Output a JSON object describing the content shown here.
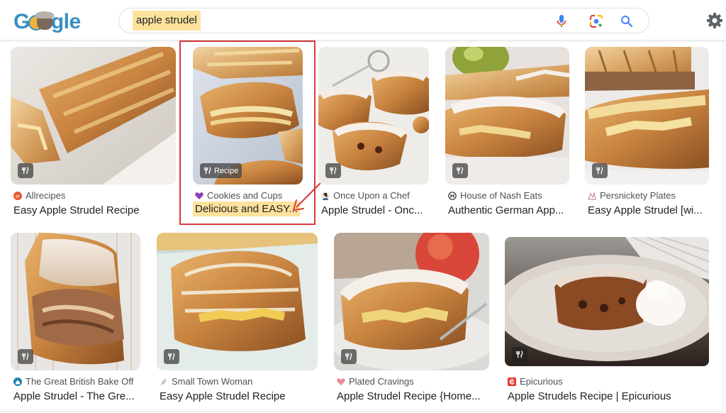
{
  "header": {
    "logo_letters": {
      "g": "G",
      "rest": "gle"
    },
    "search_query": "apple strudel",
    "icons": [
      "microphone-icon",
      "google-lens-icon",
      "search-icon",
      "settings-gear-icon"
    ]
  },
  "colors": {
    "highlight": "#fde29c",
    "annotation_red": "#d93a3a",
    "logo_blue": "#3a8fc2"
  },
  "results": [
    {
      "source": "Allrecipes",
      "title": "Easy Apple Strudel Recipe",
      "badge": "",
      "favicon": "allrecipes-icon"
    },
    {
      "source": "Cookies and Cups",
      "title": "Delicious and EASY...",
      "badge": "Recipe",
      "favicon": "purple-heart-icon",
      "highlighted": true
    },
    {
      "source": "Once Upon a Chef",
      "title": "Apple Strudel - Onc...",
      "badge": "",
      "favicon": "chef-avatar-icon"
    },
    {
      "source": "House of Nash Eats",
      "title": "Authentic German App...",
      "badge": "",
      "favicon": "house-of-nash-icon"
    },
    {
      "source": "Persnickety Plates",
      "title": "Easy Apple Strudel [wi...",
      "badge": "",
      "favicon": "persnickety-icon"
    },
    {
      "source": "The Great British Bake Off",
      "title": "Apple Strudel - The Gre...",
      "badge": "",
      "favicon": "gbbo-icon"
    },
    {
      "source": "Small Town Woman",
      "title": "Easy Apple Strudel Recipe",
      "badge": "",
      "favicon": "small-town-woman-icon"
    },
    {
      "source": "Plated Cravings",
      "title": "Apple Strudel Recipe {Home...",
      "badge": "",
      "favicon": "pink-heart-icon"
    },
    {
      "source": "Epicurious",
      "title": "Apple Strudels Recipe | Epicurious",
      "badge": "",
      "favicon": "epicurious-icon"
    }
  ]
}
